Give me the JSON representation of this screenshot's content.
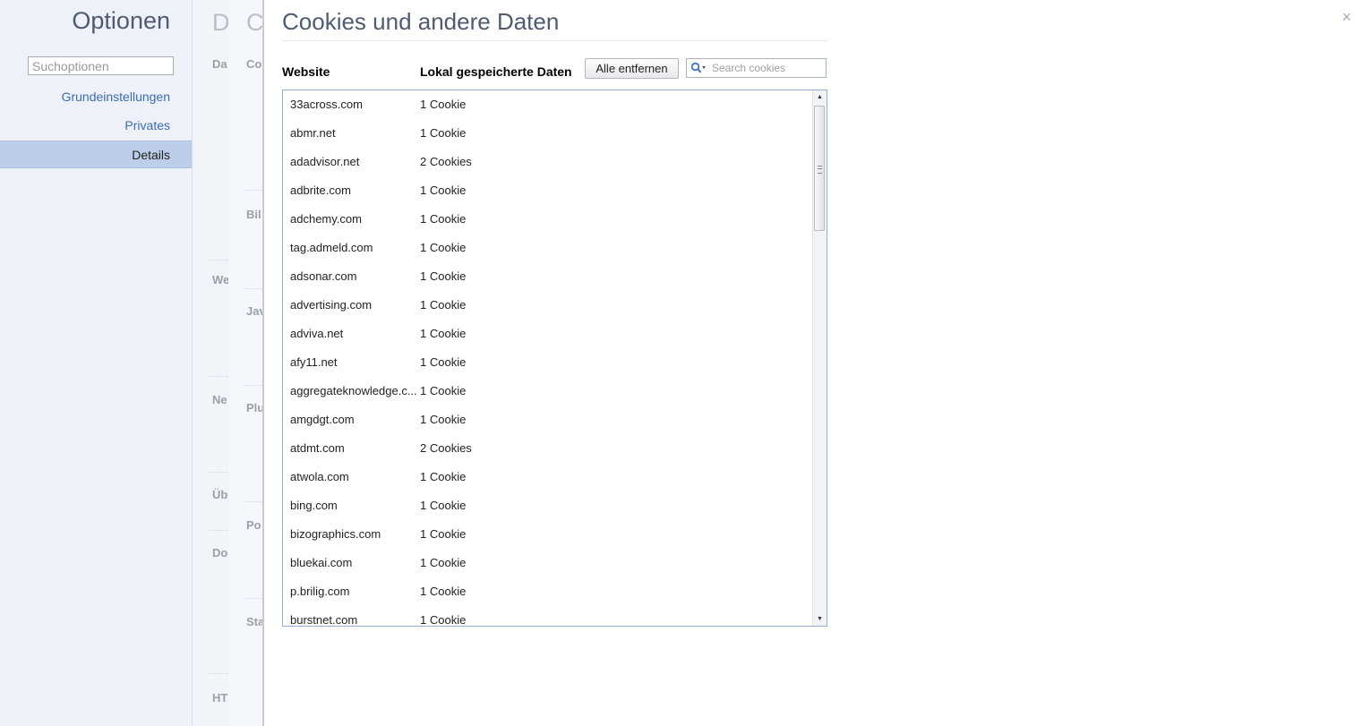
{
  "sidebar": {
    "title": "Optionen",
    "search_placeholder": "Suchoptionen",
    "items": [
      {
        "label": "Grundeinstellungen",
        "selected": false
      },
      {
        "label": "Privates",
        "selected": false
      },
      {
        "label": "Details",
        "selected": true
      }
    ]
  },
  "background_pages": {
    "layer1": {
      "title_fragment": "D",
      "labels": [
        "Da",
        "We",
        "Ne",
        "Üb",
        "Do",
        "HT"
      ]
    },
    "layer2": {
      "title_fragment": "C",
      "labels": [
        "Co",
        "Bil",
        "Jav",
        "Plu",
        "Po",
        "Sta"
      ]
    }
  },
  "dialog": {
    "title": "Cookies und andere Daten",
    "close_label": "×",
    "columns": {
      "website": "Website",
      "data": "Lokal gespeicherte Daten"
    },
    "remove_all_label": "Alle entfernen",
    "search_placeholder": "Search cookies",
    "rows": [
      {
        "site": "33across.com",
        "count": "1 Cookie"
      },
      {
        "site": "abmr.net",
        "count": "1 Cookie"
      },
      {
        "site": "adadvisor.net",
        "count": "2 Cookies"
      },
      {
        "site": "adbrite.com",
        "count": "1 Cookie"
      },
      {
        "site": "adchemy.com",
        "count": "1 Cookie"
      },
      {
        "site": "tag.admeld.com",
        "count": "1 Cookie"
      },
      {
        "site": "adsonar.com",
        "count": "1 Cookie"
      },
      {
        "site": "advertising.com",
        "count": "1 Cookie"
      },
      {
        "site": "adviva.net",
        "count": "1 Cookie"
      },
      {
        "site": "afy11.net",
        "count": "1 Cookie"
      },
      {
        "site": "aggregateknowledge.c...",
        "count": "1 Cookie"
      },
      {
        "site": "amgdgt.com",
        "count": "1 Cookie"
      },
      {
        "site": "atdmt.com",
        "count": "2 Cookies"
      },
      {
        "site": "atwola.com",
        "count": "1 Cookie"
      },
      {
        "site": "bing.com",
        "count": "1 Cookie"
      },
      {
        "site": "bizographics.com",
        "count": "1 Cookie"
      },
      {
        "site": "bluekai.com",
        "count": "1 Cookie"
      },
      {
        "site": "p.brilig.com",
        "count": "1 Cookie"
      },
      {
        "site": "burstnet.com",
        "count": "1 Cookie"
      }
    ]
  },
  "colors": {
    "accent_link": "#3a6cb8",
    "selected_nav": "#bccee9",
    "title_text": "#4f5b70",
    "list_border": "#8fb2d8"
  }
}
